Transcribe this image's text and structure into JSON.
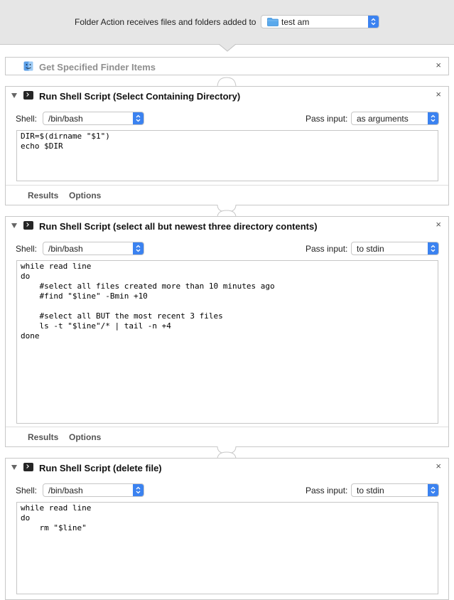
{
  "header": {
    "label": "Folder Action receives files and folders added to",
    "folder_value": "test am"
  },
  "actions": [
    {
      "title": "Get Specified Finder Items"
    },
    {
      "title": "Run Shell Script (Select Containing Directory)",
      "shell_label": "Shell:",
      "shell_value": "/bin/bash",
      "pass_label": "Pass input:",
      "pass_value": "as arguments",
      "script": "DIR=$(dirname \"$1\")\necho $DIR",
      "results_label": "Results",
      "options_label": "Options"
    },
    {
      "title": "Run Shell Script (select all but newest three directory contents)",
      "shell_label": "Shell:",
      "shell_value": "/bin/bash",
      "pass_label": "Pass input:",
      "pass_value": "to stdin",
      "script": "while read line\ndo\n    #select all files created more than 10 minutes ago\n    #find \"$line\" -Bmin +10\n\n    #select all BUT the most recent 3 files\n    ls -t \"$line\"/* | tail -n +4\ndone",
      "results_label": "Results",
      "options_label": "Options"
    },
    {
      "title": "Run Shell Script (delete file)",
      "shell_label": "Shell:",
      "shell_value": "/bin/bash",
      "pass_label": "Pass input:",
      "pass_value": "to stdin",
      "script": "while read line\ndo\n    rm \"$line\""
    }
  ],
  "icons": {
    "close": "×"
  },
  "colors": {
    "accent": "#3b82f0",
    "header_bg": "#e6e6e6"
  }
}
